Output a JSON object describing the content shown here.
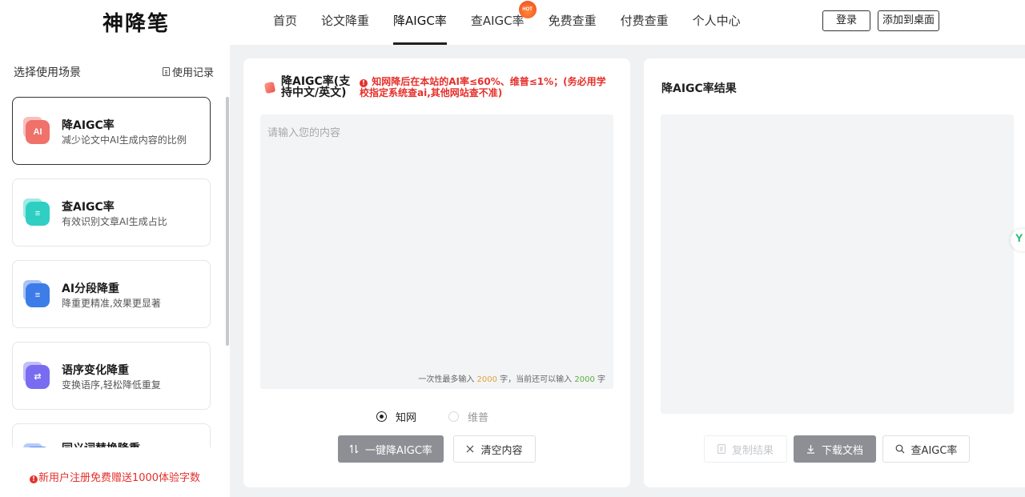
{
  "header": {
    "logo": "神降笔",
    "nav": [
      "首页",
      "论文降重",
      "降AIGC率",
      "查AIGC率",
      "免费查重",
      "付费查重",
      "个人中心"
    ],
    "active_nav": "降AIGC率",
    "hot_badge": "HOT",
    "login_label": "登录",
    "add_desktop_label": "添加到桌面"
  },
  "sidebar": {
    "title": "选择使用场景",
    "history_label": "使用记录",
    "scenes": [
      {
        "name": "降AIGC率",
        "desc": "减少论文中AI生成内容的比例",
        "icon": "AI",
        "color": "#f0726b"
      },
      {
        "name": "查AIGC率",
        "desc": "有效识别文章AI生成占比",
        "icon": "≡",
        "color": "#2fcfc4"
      },
      {
        "name": "AI分段降重",
        "desc": "降重更精准,效果更显著",
        "icon": "≡",
        "color": "#3d7de8"
      },
      {
        "name": "语序变化降重",
        "desc": "变换语序,轻松降低重复",
        "icon": "⇄",
        "color": "#7a6cf0"
      },
      {
        "name": "同义词替换降重",
        "desc": "",
        "icon": "≡",
        "color": "#5a8cf0"
      }
    ],
    "promo": "新用户注册免费赠送1000体验字数"
  },
  "input_panel": {
    "title": "降AIGC率(支持中文/英文)",
    "notice": "知网降后在本站的AI率≤60%、维普≤1%；(务必用学校指定系统查ai,其他网站查不准)",
    "placeholder": "请输入您的内容",
    "counter_prefix": "一次性最多输入",
    "max_chars": "2000",
    "counter_mid": "字，当前还可以输入",
    "remaining_chars": "2000",
    "counter_suffix": "字",
    "options": [
      "知网",
      "维普"
    ],
    "selected_option": "知网",
    "primary_button": "一键降AIGC率",
    "clear_button": "清空内容"
  },
  "result_panel": {
    "title": "降AIGC率结果",
    "copy_button": "复制结果",
    "download_button": "下载文档",
    "check_button": "查AIGC率"
  },
  "float_widget": "Y",
  "colors": {
    "accent_red": "#e5302b",
    "primary_gray": "#8d8f95",
    "counter_orange": "#e5a13a",
    "counter_green": "#5aad3c"
  }
}
